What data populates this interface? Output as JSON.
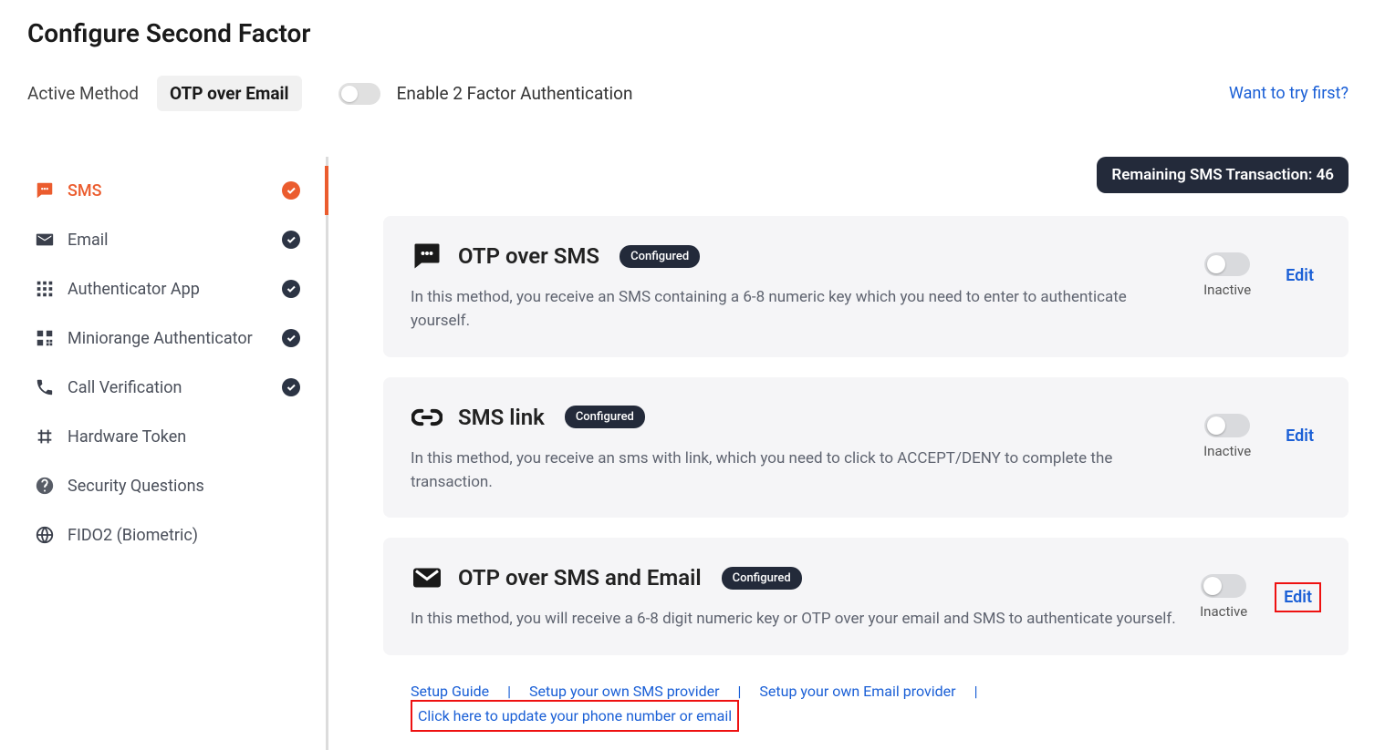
{
  "page_title": "Configure Second Factor",
  "header": {
    "active_method_label": "Active Method",
    "active_method_value": "OTP over Email",
    "enable_2fa_label": "Enable 2 Factor Authentication",
    "try_link": "Want to try first?"
  },
  "sidebar": {
    "items": [
      {
        "label": "SMS",
        "icon": "sms",
        "checked": true,
        "active": true
      },
      {
        "label": "Email",
        "icon": "email",
        "checked": true,
        "active": false
      },
      {
        "label": "Authenticator App",
        "icon": "grid",
        "checked": true,
        "active": false
      },
      {
        "label": "Miniorange Authenticator",
        "icon": "qr",
        "checked": true,
        "active": false
      },
      {
        "label": "Call Verification",
        "icon": "phone",
        "checked": true,
        "active": false
      },
      {
        "label": "Hardware Token",
        "icon": "token",
        "checked": false,
        "active": false
      },
      {
        "label": "Security Questions",
        "icon": "question",
        "checked": false,
        "active": false
      },
      {
        "label": "FIDO2 (Biometric)",
        "icon": "globe",
        "checked": false,
        "active": false
      }
    ]
  },
  "sms_remaining_label": "Remaining SMS Transaction: 46",
  "cards": [
    {
      "icon": "sms",
      "title": "OTP over SMS",
      "configured": "Configured",
      "desc": "In this method, you receive an SMS containing a 6-8 numeric key which you need to enter to authenticate yourself.",
      "status": "Inactive",
      "edit": "Edit",
      "highlight_edit": false
    },
    {
      "icon": "link",
      "title": "SMS link",
      "configured": "Configured",
      "desc": "In this method, you receive an sms with link, which you need to click to ACCEPT/DENY to complete the transaction.",
      "status": "Inactive",
      "edit": "Edit",
      "highlight_edit": false
    },
    {
      "icon": "email",
      "title": "OTP over SMS and Email",
      "configured": "Configured",
      "desc": "In this method, you will receive a 6-8 digit numeric key or OTP over your email and SMS to authenticate yourself.",
      "status": "Inactive",
      "edit": "Edit",
      "highlight_edit": true
    }
  ],
  "footer_links": {
    "setup_guide": "Setup Guide",
    "sms_provider": "Setup your own SMS provider",
    "email_provider": "Setup your own Email provider",
    "update_phone": "Click here to update your phone number or email"
  }
}
